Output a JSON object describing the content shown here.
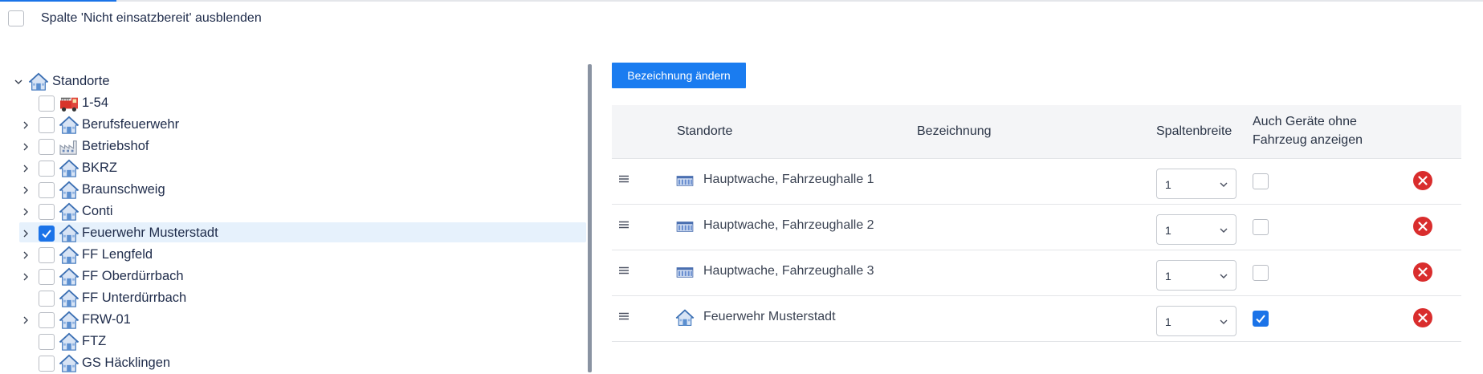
{
  "options": {
    "hide_not_ready_label": "Spalte 'Nicht einsatzbereit' ausblenden",
    "hide_not_ready_checked": false
  },
  "tree": {
    "root": {
      "label": "Standorte",
      "expanded": true,
      "icon": "house-icon"
    },
    "items": [
      {
        "label": "1-54",
        "icon": "fire-truck-icon",
        "has_children": false,
        "checked": false,
        "selected": false
      },
      {
        "label": "Berufsfeuerwehr",
        "icon": "house-icon",
        "has_children": true,
        "checked": false,
        "selected": false
      },
      {
        "label": "Betriebshof",
        "icon": "factory-icon",
        "has_children": true,
        "checked": false,
        "selected": false
      },
      {
        "label": "BKRZ",
        "icon": "house-icon",
        "has_children": true,
        "checked": false,
        "selected": false
      },
      {
        "label": "Braunschweig",
        "icon": "house-icon",
        "has_children": true,
        "checked": false,
        "selected": false
      },
      {
        "label": "Conti",
        "icon": "house-icon",
        "has_children": true,
        "checked": false,
        "selected": false
      },
      {
        "label": "Feuerwehr Musterstadt",
        "icon": "house-icon",
        "has_children": true,
        "checked": true,
        "selected": true
      },
      {
        "label": "FF Lengfeld",
        "icon": "house-icon",
        "has_children": true,
        "checked": false,
        "selected": false
      },
      {
        "label": "FF Oberdürrbach",
        "icon": "house-icon",
        "has_children": true,
        "checked": false,
        "selected": false
      },
      {
        "label": "FF Unterdürrbach",
        "icon": "house-icon",
        "has_children": false,
        "checked": false,
        "selected": false
      },
      {
        "label": "FRW-01",
        "icon": "house-icon",
        "has_children": true,
        "checked": false,
        "selected": false
      },
      {
        "label": "FTZ",
        "icon": "house-icon",
        "has_children": false,
        "checked": false,
        "selected": false
      },
      {
        "label": "GS Häcklingen",
        "icon": "house-icon",
        "has_children": false,
        "checked": false,
        "selected": false
      }
    ]
  },
  "toolbar": {
    "rename_label": "Bezeichnung ändern"
  },
  "table": {
    "headers": {
      "standorte": "Standorte",
      "bezeichnung": "Bezeichnung",
      "spaltenbreite": "Spaltenbreite",
      "auch_geraete_line1": "Auch Geräte ohne",
      "auch_geraete_line2": "Fahrzeug anzeigen"
    },
    "rows": [
      {
        "name": "Hauptwache, Fahrzeughalle 1",
        "icon": "garage-icon",
        "bezeichnung": "",
        "width": "1",
        "show_devices": false
      },
      {
        "name": "Hauptwache, Fahrzeughalle 2",
        "icon": "garage-icon",
        "bezeichnung": "",
        "width": "1",
        "show_devices": false
      },
      {
        "name": "Hauptwache, Fahrzeughalle 3",
        "icon": "garage-icon",
        "bezeichnung": "",
        "width": "1",
        "show_devices": false
      },
      {
        "name": "Feuerwehr Musterstadt",
        "icon": "house-icon",
        "bezeichnung": "",
        "width": "1",
        "show_devices": true
      }
    ]
  },
  "colors": {
    "accent": "#1a7cf0",
    "checkbox_checked": "#1b73e8",
    "delete": "#d92d2d",
    "selected_row": "#e6f1fc",
    "text": "#1e2b4a"
  }
}
